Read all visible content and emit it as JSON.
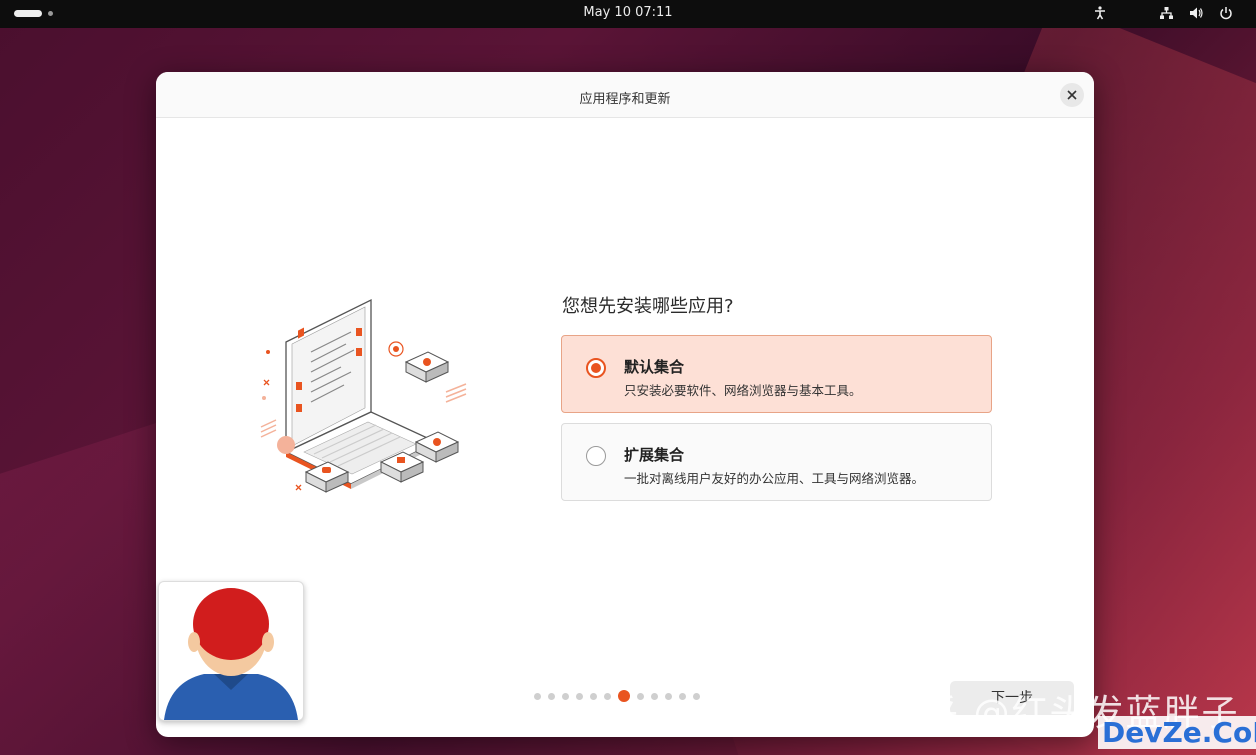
{
  "topbar": {
    "datetime": "May 10  07:11",
    "icons": [
      "accessibility-icon",
      "network-icon",
      "volume-icon",
      "power-icon"
    ]
  },
  "dialog": {
    "title": "应用程序和更新",
    "question": "您想先安装哪些应用?",
    "options": [
      {
        "title": "默认集合",
        "description": "只安装必要软件、网络浏览器与基本工具。",
        "selected": true
      },
      {
        "title": "扩展集合",
        "description": "一批对离线用户友好的办公应用、工具与网络浏览器。",
        "selected": false
      }
    ],
    "pager": {
      "total": 12,
      "current": 7
    },
    "next_label": "下一步"
  },
  "watermark": {
    "text": "知乎 @红头发蓝胖子",
    "site": "DevZe.CoM"
  },
  "colors": {
    "accent": "#e95420",
    "selected_bg": "#fde0d6"
  }
}
